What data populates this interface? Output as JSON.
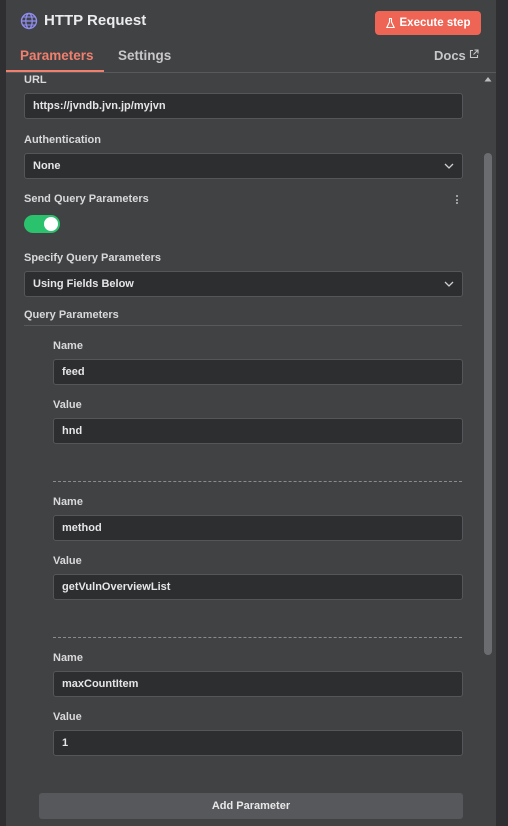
{
  "header": {
    "title": "HTTP Request",
    "execute_label": "Execute step"
  },
  "tabs": {
    "parameters": "Parameters",
    "settings": "Settings",
    "docs": "Docs"
  },
  "url": {
    "label": "URL",
    "value": "https://jvndb.jvn.jp/myjvn"
  },
  "authentication": {
    "label": "Authentication",
    "value": "None"
  },
  "send_query": {
    "label": "Send Query Parameters",
    "enabled": true
  },
  "specify_query": {
    "label": "Specify Query Parameters",
    "value": "Using Fields Below"
  },
  "query_parameters": {
    "label": "Query Parameters",
    "name_label": "Name",
    "value_label": "Value",
    "items": [
      {
        "name": "feed",
        "value": "hnd"
      },
      {
        "name": "method",
        "value": "getVulnOverviewList"
      },
      {
        "name": "maxCountItem",
        "value": "1"
      }
    ],
    "add_label": "Add Parameter"
  },
  "colors": {
    "accent": "#ee6555",
    "toggle_on": "#2bc26e",
    "panel_bg": "#414244",
    "input_bg": "#2d2e30"
  },
  "icons": {
    "title": "globe-icon",
    "execute": "flask-icon",
    "docs": "external-link-icon",
    "select": "chevron-down-icon",
    "options": "kebab-menu-icon"
  }
}
